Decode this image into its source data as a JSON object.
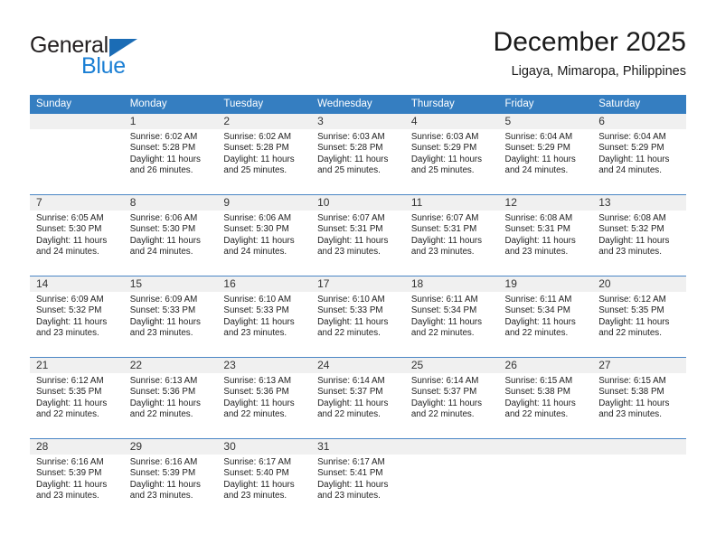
{
  "logo": {
    "word_one": "General",
    "word_two": "Blue",
    "triangle_color": "#1b6cb5",
    "blue_color": "#1b7fd4"
  },
  "header": {
    "title": "December 2025",
    "subtitle": "Ligaya, Mimaropa, Philippines"
  },
  "colors": {
    "header_row_bg": "#357ec1",
    "header_row_text": "#ffffff",
    "daynum_bg": "#f0f0f0",
    "row_divider": "#4a86c5",
    "cell_bg": "#ffffff"
  },
  "calendar": {
    "weekday_headers": [
      "Sunday",
      "Monday",
      "Tuesday",
      "Wednesday",
      "Thursday",
      "Friday",
      "Saturday"
    ],
    "labels": {
      "sunrise": "Sunrise:",
      "sunset": "Sunset:",
      "daylight": "Daylight:"
    },
    "weeks": [
      [
        {
          "day": "",
          "blank": true,
          "sunrise": "",
          "sunset": "",
          "daylight": ""
        },
        {
          "day": "1",
          "blank": false,
          "sunrise": "Sunrise: 6:02 AM",
          "sunset": "Sunset: 5:28 PM",
          "daylight": "Daylight: 11 hours and 26 minutes."
        },
        {
          "day": "2",
          "blank": false,
          "sunrise": "Sunrise: 6:02 AM",
          "sunset": "Sunset: 5:28 PM",
          "daylight": "Daylight: 11 hours and 25 minutes."
        },
        {
          "day": "3",
          "blank": false,
          "sunrise": "Sunrise: 6:03 AM",
          "sunset": "Sunset: 5:28 PM",
          "daylight": "Daylight: 11 hours and 25 minutes."
        },
        {
          "day": "4",
          "blank": false,
          "sunrise": "Sunrise: 6:03 AM",
          "sunset": "Sunset: 5:29 PM",
          "daylight": "Daylight: 11 hours and 25 minutes."
        },
        {
          "day": "5",
          "blank": false,
          "sunrise": "Sunrise: 6:04 AM",
          "sunset": "Sunset: 5:29 PM",
          "daylight": "Daylight: 11 hours and 24 minutes."
        },
        {
          "day": "6",
          "blank": false,
          "sunrise": "Sunrise: 6:04 AM",
          "sunset": "Sunset: 5:29 PM",
          "daylight": "Daylight: 11 hours and 24 minutes."
        }
      ],
      [
        {
          "day": "7",
          "blank": false,
          "sunrise": "Sunrise: 6:05 AM",
          "sunset": "Sunset: 5:30 PM",
          "daylight": "Daylight: 11 hours and 24 minutes."
        },
        {
          "day": "8",
          "blank": false,
          "sunrise": "Sunrise: 6:06 AM",
          "sunset": "Sunset: 5:30 PM",
          "daylight": "Daylight: 11 hours and 24 minutes."
        },
        {
          "day": "9",
          "blank": false,
          "sunrise": "Sunrise: 6:06 AM",
          "sunset": "Sunset: 5:30 PM",
          "daylight": "Daylight: 11 hours and 24 minutes."
        },
        {
          "day": "10",
          "blank": false,
          "sunrise": "Sunrise: 6:07 AM",
          "sunset": "Sunset: 5:31 PM",
          "daylight": "Daylight: 11 hours and 23 minutes."
        },
        {
          "day": "11",
          "blank": false,
          "sunrise": "Sunrise: 6:07 AM",
          "sunset": "Sunset: 5:31 PM",
          "daylight": "Daylight: 11 hours and 23 minutes."
        },
        {
          "day": "12",
          "blank": false,
          "sunrise": "Sunrise: 6:08 AM",
          "sunset": "Sunset: 5:31 PM",
          "daylight": "Daylight: 11 hours and 23 minutes."
        },
        {
          "day": "13",
          "blank": false,
          "sunrise": "Sunrise: 6:08 AM",
          "sunset": "Sunset: 5:32 PM",
          "daylight": "Daylight: 11 hours and 23 minutes."
        }
      ],
      [
        {
          "day": "14",
          "blank": false,
          "sunrise": "Sunrise: 6:09 AM",
          "sunset": "Sunset: 5:32 PM",
          "daylight": "Daylight: 11 hours and 23 minutes."
        },
        {
          "day": "15",
          "blank": false,
          "sunrise": "Sunrise: 6:09 AM",
          "sunset": "Sunset: 5:33 PM",
          "daylight": "Daylight: 11 hours and 23 minutes."
        },
        {
          "day": "16",
          "blank": false,
          "sunrise": "Sunrise: 6:10 AM",
          "sunset": "Sunset: 5:33 PM",
          "daylight": "Daylight: 11 hours and 23 minutes."
        },
        {
          "day": "17",
          "blank": false,
          "sunrise": "Sunrise: 6:10 AM",
          "sunset": "Sunset: 5:33 PM",
          "daylight": "Daylight: 11 hours and 22 minutes."
        },
        {
          "day": "18",
          "blank": false,
          "sunrise": "Sunrise: 6:11 AM",
          "sunset": "Sunset: 5:34 PM",
          "daylight": "Daylight: 11 hours and 22 minutes."
        },
        {
          "day": "19",
          "blank": false,
          "sunrise": "Sunrise: 6:11 AM",
          "sunset": "Sunset: 5:34 PM",
          "daylight": "Daylight: 11 hours and 22 minutes."
        },
        {
          "day": "20",
          "blank": false,
          "sunrise": "Sunrise: 6:12 AM",
          "sunset": "Sunset: 5:35 PM",
          "daylight": "Daylight: 11 hours and 22 minutes."
        }
      ],
      [
        {
          "day": "21",
          "blank": false,
          "sunrise": "Sunrise: 6:12 AM",
          "sunset": "Sunset: 5:35 PM",
          "daylight": "Daylight: 11 hours and 22 minutes."
        },
        {
          "day": "22",
          "blank": false,
          "sunrise": "Sunrise: 6:13 AM",
          "sunset": "Sunset: 5:36 PM",
          "daylight": "Daylight: 11 hours and 22 minutes."
        },
        {
          "day": "23",
          "blank": false,
          "sunrise": "Sunrise: 6:13 AM",
          "sunset": "Sunset: 5:36 PM",
          "daylight": "Daylight: 11 hours and 22 minutes."
        },
        {
          "day": "24",
          "blank": false,
          "sunrise": "Sunrise: 6:14 AM",
          "sunset": "Sunset: 5:37 PM",
          "daylight": "Daylight: 11 hours and 22 minutes."
        },
        {
          "day": "25",
          "blank": false,
          "sunrise": "Sunrise: 6:14 AM",
          "sunset": "Sunset: 5:37 PM",
          "daylight": "Daylight: 11 hours and 22 minutes."
        },
        {
          "day": "26",
          "blank": false,
          "sunrise": "Sunrise: 6:15 AM",
          "sunset": "Sunset: 5:38 PM",
          "daylight": "Daylight: 11 hours and 22 minutes."
        },
        {
          "day": "27",
          "blank": false,
          "sunrise": "Sunrise: 6:15 AM",
          "sunset": "Sunset: 5:38 PM",
          "daylight": "Daylight: 11 hours and 23 minutes."
        }
      ],
      [
        {
          "day": "28",
          "blank": false,
          "sunrise": "Sunrise: 6:16 AM",
          "sunset": "Sunset: 5:39 PM",
          "daylight": "Daylight: 11 hours and 23 minutes."
        },
        {
          "day": "29",
          "blank": false,
          "sunrise": "Sunrise: 6:16 AM",
          "sunset": "Sunset: 5:39 PM",
          "daylight": "Daylight: 11 hours and 23 minutes."
        },
        {
          "day": "30",
          "blank": false,
          "sunrise": "Sunrise: 6:17 AM",
          "sunset": "Sunset: 5:40 PM",
          "daylight": "Daylight: 11 hours and 23 minutes."
        },
        {
          "day": "31",
          "blank": false,
          "sunrise": "Sunrise: 6:17 AM",
          "sunset": "Sunset: 5:41 PM",
          "daylight": "Daylight: 11 hours and 23 minutes."
        },
        {
          "day": "",
          "blank": true,
          "sunrise": "",
          "sunset": "",
          "daylight": ""
        },
        {
          "day": "",
          "blank": true,
          "sunrise": "",
          "sunset": "",
          "daylight": ""
        },
        {
          "day": "",
          "blank": true,
          "sunrise": "",
          "sunset": "",
          "daylight": ""
        }
      ]
    ]
  }
}
